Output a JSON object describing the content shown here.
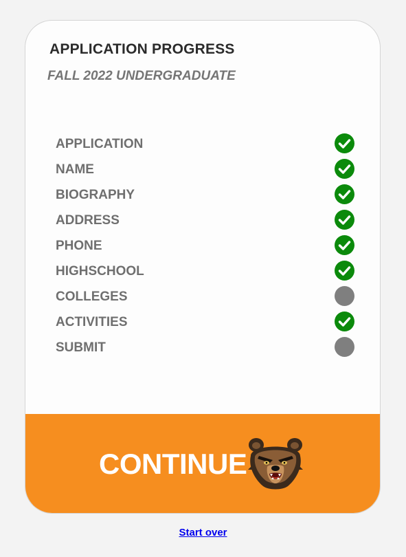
{
  "header": {
    "title": "APPLICATION PROGRESS",
    "subtitle": "FALL 2022 UNDERGRADUATE"
  },
  "steps": [
    {
      "label": "APPLICATION",
      "status": "complete",
      "icon": "check-circle-icon"
    },
    {
      "label": "NAME",
      "status": "complete",
      "icon": "check-circle-icon"
    },
    {
      "label": "BIOGRAPHY",
      "status": "complete",
      "icon": "check-circle-icon"
    },
    {
      "label": "ADDRESS",
      "status": "complete",
      "icon": "check-circle-icon"
    },
    {
      "label": "PHONE",
      "status": "complete",
      "icon": "check-circle-icon"
    },
    {
      "label": "HIGHSCHOOL",
      "status": "complete",
      "icon": "check-circle-icon"
    },
    {
      "label": "COLLEGES",
      "status": "incomplete",
      "icon": "gray-circle-icon"
    },
    {
      "label": "ACTIVITIES",
      "status": "complete",
      "icon": "check-circle-icon"
    },
    {
      "label": "SUBMIT",
      "status": "incomplete",
      "icon": "gray-circle-icon"
    }
  ],
  "continue_button": {
    "label": "CONTINUE",
    "icon": "bear-mascot-icon"
  },
  "start_over_link": {
    "label": "Start over"
  },
  "colors": {
    "accent": "#f68e1f",
    "complete": "#0b8a0b",
    "incomplete": "#7f7f7f",
    "link": "#0000ee"
  }
}
